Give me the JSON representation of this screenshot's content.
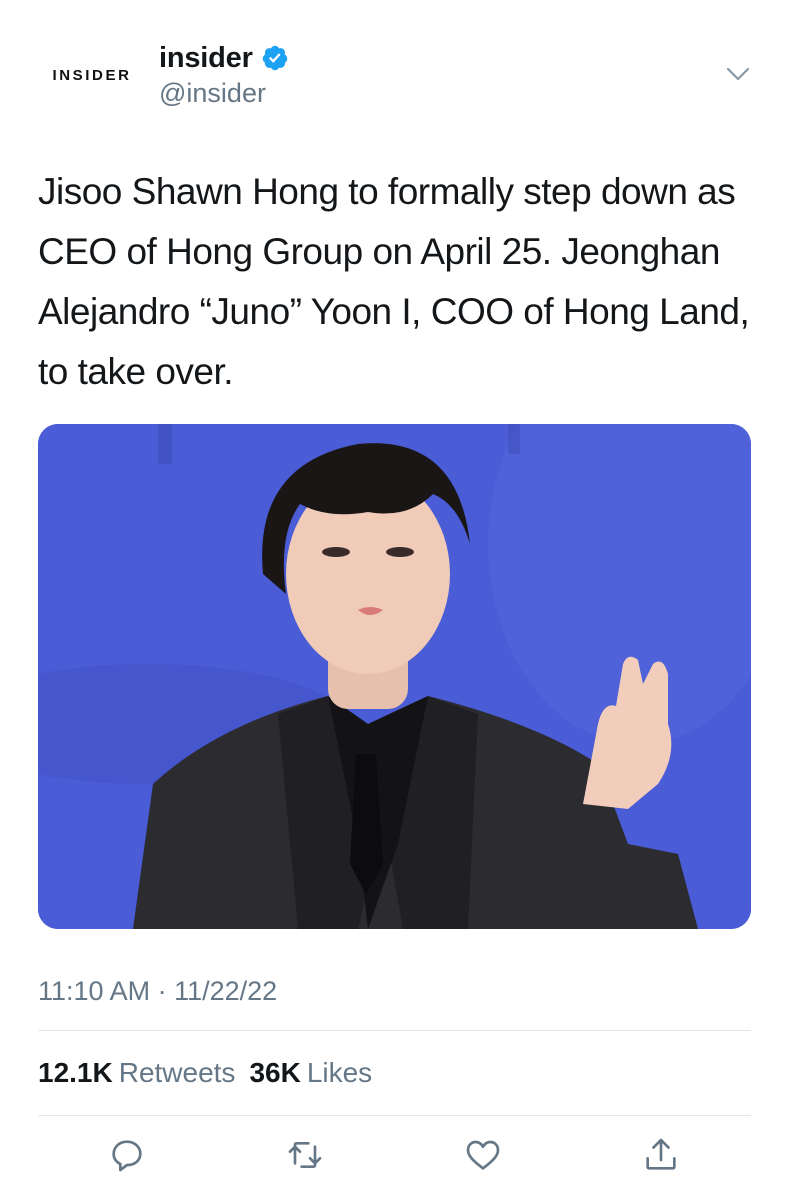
{
  "account": {
    "avatar_text": "INSIDER",
    "display_name": "insider",
    "handle": "@insider",
    "verified": true
  },
  "tweet": {
    "text": "Jisoo Shawn Hong to formally step down as CEO of Hong Group on April 25. Jeonghan Alejandro “Juno” Yoon I, COO of Hong Land, to take over.",
    "timestamp": "11:10 AM · 11/22/22"
  },
  "stats": {
    "retweets_count": "12.1K",
    "retweets_label": "Retweets",
    "likes_count": "36K",
    "likes_label": "Likes"
  },
  "actions": [
    "reply-icon",
    "retweet-icon",
    "like-icon",
    "share-icon"
  ],
  "colors": {
    "verified_blue": "#1da1f2",
    "secondary_text": "#657786",
    "media_background": "#4b5bd4"
  }
}
